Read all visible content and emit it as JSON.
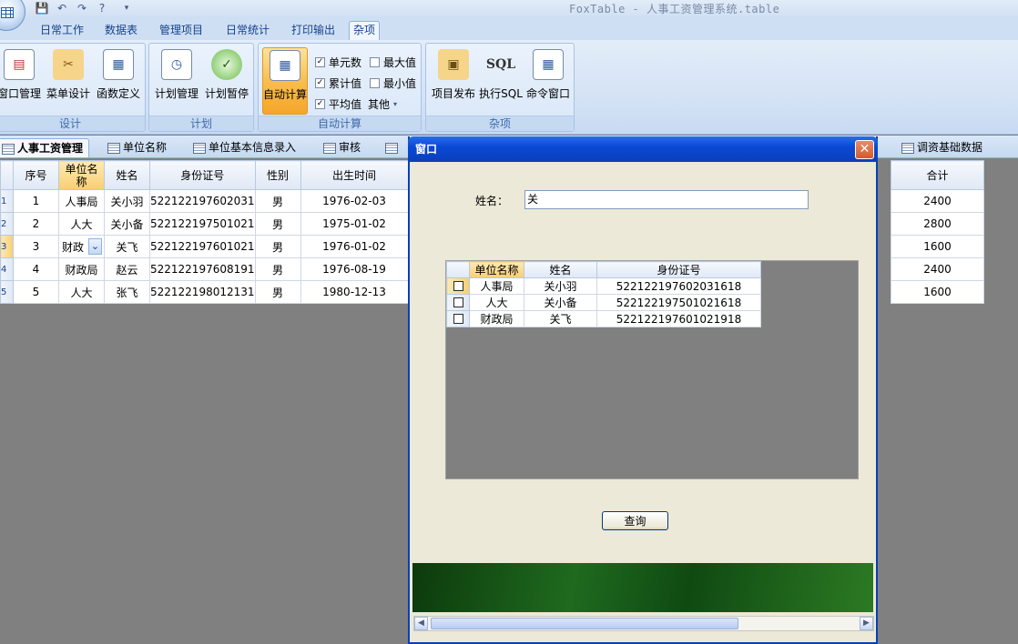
{
  "app": {
    "title": "FoxTable - 人事工资管理系统.table"
  },
  "ribbon": {
    "tabs": [
      "日常工作",
      "数据表",
      "管理项目",
      "日常统计",
      "打印输出",
      "杂项"
    ],
    "active_tab": "杂项",
    "groups": {
      "design": {
        "title": "设计",
        "buttons": [
          "窗口管理",
          "菜单设计",
          "函数定义"
        ]
      },
      "plan": {
        "title": "计划",
        "buttons": [
          "计划管理",
          "计划暂停"
        ]
      },
      "autocalc": {
        "title": "自动计算",
        "button": "自动计算",
        "checks": {
          "cells": "单元数",
          "max": "最大值",
          "cumulative": "累计值",
          "min": "最小值",
          "avg": "平均值",
          "other": "其他"
        }
      },
      "misc": {
        "title": "杂项",
        "buttons": [
          "项目发布",
          "执行SQL",
          "命令窗口"
        ],
        "sql_icon": "SQL"
      }
    }
  },
  "doc_tabs": {
    "items": [
      "人事工资管理",
      "单位名称",
      "单位基本信息录入",
      "审核",
      "调资基础数据"
    ],
    "active": "人事工资管理"
  },
  "grid": {
    "headers": [
      "序号",
      "单位名称",
      "姓名",
      "身份证号",
      "性别",
      "出生时间"
    ],
    "right_header": "合计",
    "rows": [
      {
        "rh": "1",
        "cells": [
          "1",
          "人事局",
          "关小羽",
          "522122197602031",
          "男",
          "1976-02-03"
        ],
        "total": "2400"
      },
      {
        "rh": "2",
        "cells": [
          "2",
          "人大",
          "关小备",
          "522122197501021",
          "男",
          "1975-01-02"
        ],
        "total": "2800"
      },
      {
        "rh": "3",
        "cells": [
          "3",
          "财政",
          "关飞",
          "522122197601021",
          "男",
          "1976-01-02"
        ],
        "total": "1600"
      },
      {
        "rh": "4",
        "cells": [
          "4",
          "财政局",
          "赵云",
          "522122197608191",
          "男",
          "1976-08-19"
        ],
        "total": "2400"
      },
      {
        "rh": "5",
        "cells": [
          "5",
          "人大",
          "张飞",
          "522122198012131",
          "男",
          "1980-12-13"
        ],
        "total": "1600"
      }
    ]
  },
  "dialog": {
    "title": "窗口",
    "close": "✕",
    "name_label": "姓名：",
    "name_value": "关",
    "result_grid": {
      "headers": [
        "单位名称",
        "姓名",
        "身份证号"
      ],
      "rows": [
        [
          "人事局",
          "关小羽",
          "522122197602031618"
        ],
        [
          "人大",
          "关小备",
          "522122197501021618"
        ],
        [
          "财政局",
          "关飞",
          "522122197601021918"
        ]
      ]
    },
    "query_button": "查询"
  },
  "colors": {
    "ribbon_accent": "#15428b",
    "dialog_title": "#0a49d6",
    "selected_header": "#f8cf72"
  }
}
